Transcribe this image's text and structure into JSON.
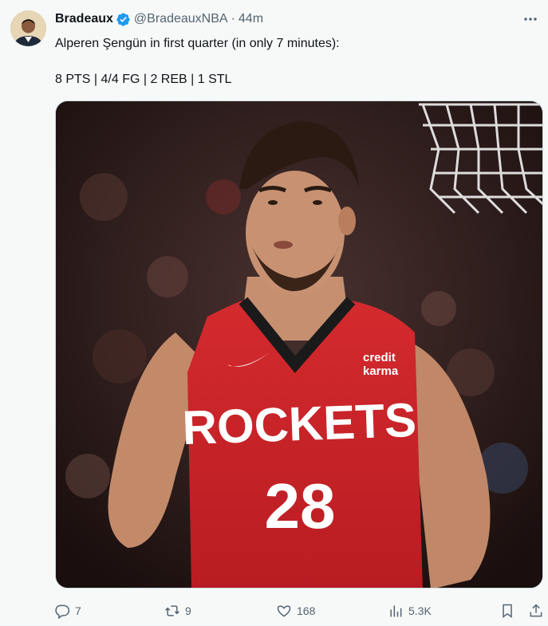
{
  "author": {
    "display_name": "Bradeaux",
    "handle": "@BradeauxNBA",
    "timestamp": "44m",
    "verified": true,
    "separator": "·"
  },
  "tweet": {
    "line1": "Alperen Şengün in first quarter (in only 7 minutes):",
    "line2": "8 PTS | 4/4 FG | 2 REB | 1 STL"
  },
  "media": {
    "jersey_team": "ROCKETS",
    "jersey_number": "28",
    "sponsor_line1": "credit",
    "sponsor_line2": "karma"
  },
  "actions": {
    "replies": "7",
    "reposts": "9",
    "likes": "168",
    "views": "5.3K"
  },
  "colors": {
    "verified_blue": "#1d9bf0",
    "muted_text": "#536471",
    "jersey_red": "#ce1141"
  }
}
